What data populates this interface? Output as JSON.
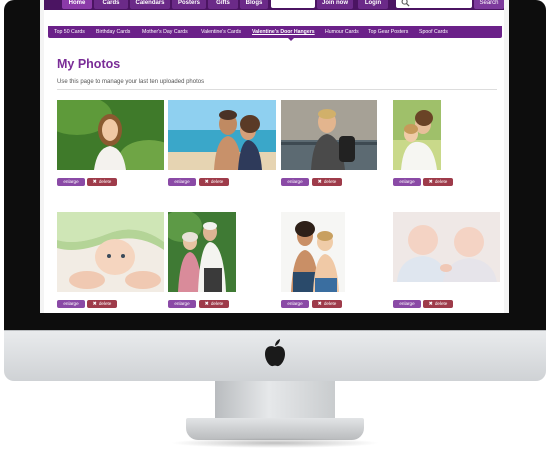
{
  "nav": {
    "tabs": [
      {
        "label": "Home",
        "active": true
      },
      {
        "label": "Cards",
        "active": false
      },
      {
        "label": "Calendars",
        "active": false
      },
      {
        "label": "Posters",
        "active": false
      },
      {
        "label": "Gifts",
        "active": false
      },
      {
        "label": "Blogs",
        "active": false
      }
    ],
    "join_label": "Join now",
    "login_label": "Login",
    "search_label": "Search"
  },
  "subnav": {
    "items": [
      {
        "label": "Top 50 Cards",
        "active": false
      },
      {
        "label": "Birthday Cards",
        "active": false
      },
      {
        "label": "Mother's Day Cards",
        "active": false
      },
      {
        "label": "Valentine's Cards",
        "active": false
      },
      {
        "label": "Valentine's Door Hangers",
        "active": true
      },
      {
        "label": "Humour Cards",
        "active": false
      },
      {
        "label": "Top Gear Posters",
        "active": false
      },
      {
        "label": "Spoof Cards",
        "active": false
      }
    ]
  },
  "main": {
    "title": "My Photos",
    "subtitle": "Use this page to manage your last ten uploaded photos",
    "enlarge_label": "enlarge",
    "delete_label": "delete",
    "photos": [
      {
        "subject": "girl-in-garden"
      },
      {
        "subject": "couple-at-beach"
      },
      {
        "subject": "boy-with-backpack"
      },
      {
        "subject": "mother-and-child"
      },
      {
        "subject": "baby-under-blanket"
      },
      {
        "subject": "elderly-couple"
      },
      {
        "subject": "woman-and-boy"
      },
      {
        "subject": "twin-babies"
      }
    ]
  },
  "colors": {
    "brand_purple": "#6b2189",
    "title_purple": "#7a2c97",
    "enlarge_button": "#8a4aa6",
    "delete_button": "#9e3b4a"
  }
}
